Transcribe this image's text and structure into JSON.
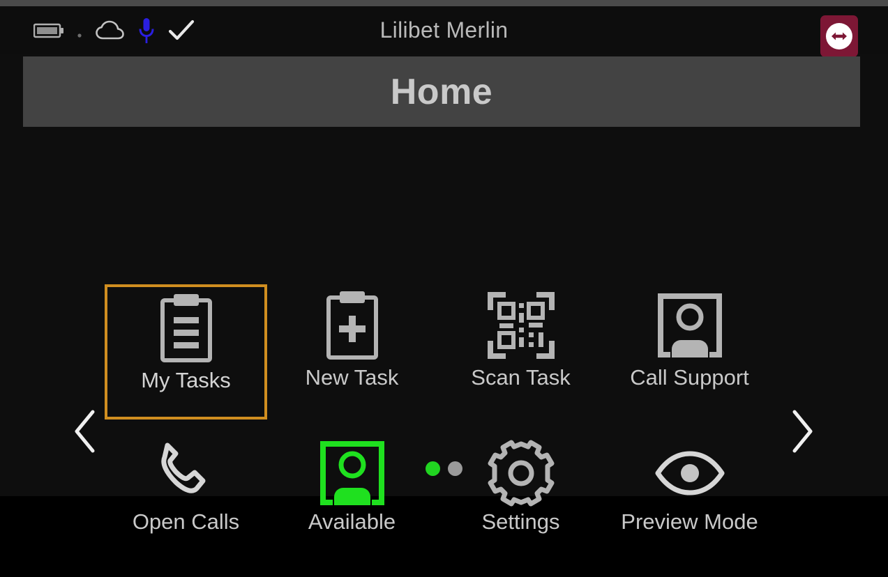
{
  "status_bar": {
    "title": "Lilibet Merlin",
    "icons": [
      {
        "name": "battery-icon",
        "label": "battery"
      },
      {
        "name": "dot-indicator-icon",
        "label": "dot"
      },
      {
        "name": "cloud-icon",
        "label": "cloud"
      },
      {
        "name": "microphone-icon",
        "label": "microphone",
        "color": "#2a1fe0"
      },
      {
        "name": "checkmark-icon",
        "label": "check"
      }
    ],
    "remote_badge": {
      "name": "teamviewer-remote-icon",
      "label": "remote control active",
      "background": "#7d1735",
      "circle_color": "#ffffff"
    }
  },
  "header": {
    "title": "Home",
    "background": "#434343",
    "text_color": "#c9c9c9"
  },
  "nav": {
    "prev_label": "‹",
    "next_label": "›",
    "prev_name": "chevron-left-icon",
    "next_name": "chevron-right-icon"
  },
  "colors": {
    "background": "#0e0e0e",
    "selection": "#d08e20",
    "icon_default": "#b4b4b4",
    "available_green": "#1fe01f",
    "label": "#c9c9c9"
  },
  "grid": {
    "selected_index": 0,
    "tiles": [
      {
        "label": "My Tasks",
        "icon": "clipboard-list-icon",
        "selected": true,
        "icon_color": "#b4b4b4"
      },
      {
        "label": "New Task",
        "icon": "clipboard-plus-icon",
        "selected": false,
        "icon_color": "#b4b4b4"
      },
      {
        "label": "Scan Task",
        "icon": "qr-code-scan-icon",
        "selected": false,
        "icon_color": "#b4b4b4"
      },
      {
        "label": "Call Support",
        "icon": "user-frame-icon",
        "selected": false,
        "icon_color": "#b4b4b4"
      },
      {
        "label": "Open Calls",
        "icon": "phone-handset-icon",
        "selected": false,
        "icon_color": "#b4b4b4"
      },
      {
        "label": "Available",
        "icon": "user-frame-icon",
        "selected": false,
        "icon_color": "#1fe01f"
      },
      {
        "label": "Settings",
        "icon": "gear-icon",
        "selected": false,
        "icon_color": "#b4b4b4"
      },
      {
        "label": "Preview Mode",
        "icon": "eye-icon",
        "selected": false,
        "icon_color": "#b4b4b4"
      }
    ]
  },
  "pager": {
    "total": 2,
    "current": 1,
    "active_color": "#21d421",
    "inactive_color": "#9a9a9a"
  }
}
